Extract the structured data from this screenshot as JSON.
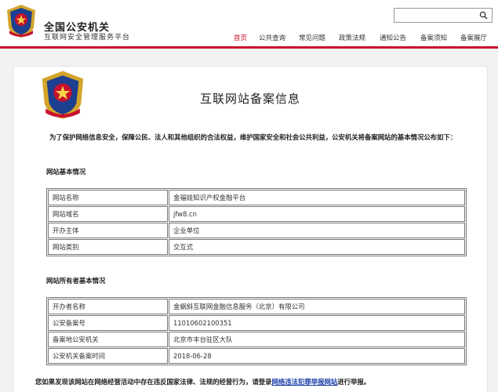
{
  "header": {
    "site_name": "全国公安机关",
    "site_subtitle": "互联网安全管理服务平台",
    "search": {
      "placeholder": "",
      "value": ""
    }
  },
  "nav": [
    {
      "label": "首页",
      "active": true
    },
    {
      "label": "公共查询",
      "active": false
    },
    {
      "label": "常见问题",
      "active": false
    },
    {
      "label": "政策法规",
      "active": false
    },
    {
      "label": "通知公告",
      "active": false
    },
    {
      "label": "备案须知",
      "active": false
    },
    {
      "label": "备案展厅",
      "active": false
    }
  ],
  "page": {
    "title": "互联网站备案信息",
    "intro": "为了保护网络信息安全，保障公民、法人和其他组织的合法权益，维护国家安全和社会公共利益，公安机关将备案网站的基本情况公布如下："
  },
  "site_info": {
    "section_title": "网站基本情况",
    "rows": [
      {
        "key": "网站名称",
        "value": "金福娃知识产权金融平台"
      },
      {
        "key": "网站域名",
        "value": "jfw8.cn"
      },
      {
        "key": "开办主体",
        "value": "企业单位"
      },
      {
        "key": "网站类别",
        "value": "交互式"
      }
    ]
  },
  "owner_info": {
    "section_title": "网站所有者基本情况",
    "rows": [
      {
        "key": "开办者名称",
        "value": "金蜗斜互联网金融信息服务（北京）有限公司"
      },
      {
        "key": "公安备案号",
        "value": "11010602100351"
      },
      {
        "key": "备案地公安机关",
        "value": "北京市丰台驻区大队"
      },
      {
        "key": "公安机关备案时间",
        "value": "2018-06-28"
      }
    ]
  },
  "footer": {
    "prefix": "您如果发现该网站在网络经营活动中存在违反国家法律、法规的经营行为，请登录",
    "link": "网络违法犯罪举报网站",
    "suffix": "进行举报。"
  },
  "colors": {
    "accent_red": "#c8102e",
    "link_blue": "#1a3fa8"
  },
  "icons": {
    "emblem": "national-police-emblem-icon",
    "search": "search-icon"
  }
}
